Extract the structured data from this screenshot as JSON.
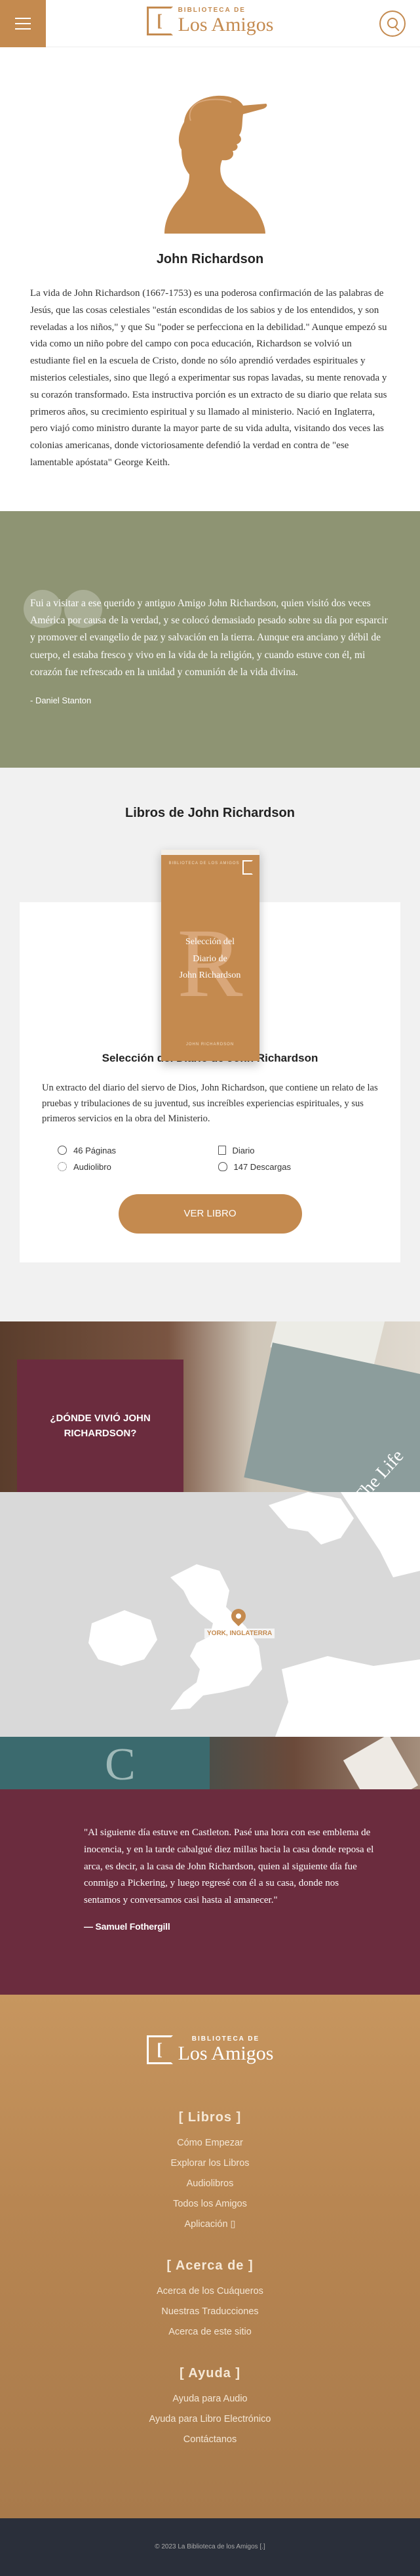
{
  "header": {
    "menu_icon": "hamburger-icon",
    "logo_small": "BIBLIOTECA DE",
    "logo_big": "Los Amigos",
    "logo_glyph": "[",
    "search_icon": "search-icon"
  },
  "bio": {
    "name": "John Richardson",
    "text": "La vida de John Richardson (1667-1753) es una poderosa confirmación de las palabras de Jesús, que las cosas celestiales \"están escondidas de los sabios y de los entendidos, y son reveladas a los niños,\" y que Su \"poder se perfecciona en la debilidad.\" Aunque empezó su vida como un niño pobre del campo con poca educación, Richardson se volvió un estudiante fiel en la escuela de Cristo, donde no sólo aprendió verdades espirituales y misterios celestiales, sino que llegó a experimentar sus ropas lavadas, su mente renovada y su corazón transformado. Esta instructiva porción es un extracto de su diario que relata sus primeros años, su crecimiento espiritual y su llamado al ministerio. Nació en Inglaterra, pero viajó como ministro durante la mayor parte de su vida adulta, visitando dos veces las colonias americanas, donde victoriosamente defendió la verdad en contra de \"ese lamentable apóstata\" George Keith."
  },
  "quote1": {
    "text": "Fui a visitar a ese querido y antiguo Amigo John Richardson, quien visitó dos veces América por causa de la verdad, y se colocó demasiado pesado sobre su día por esparcir y promover el evangelio de paz y salvación en la tierra. Aunque era anciano y débil de cuerpo, el estaba fresco y vivo en la vida de la religión, y cuando estuve con él, mi corazón fue refrescado en la unidad y comunión de la vida divina.",
    "author": "- Daniel Stanton"
  },
  "books": {
    "heading": "Libros de John Richardson",
    "cover": {
      "series": "BIBLIOTECA DE LOS AMIGOS",
      "letter": "R",
      "title_lines": [
        "Selección del",
        "Diario de",
        "John Richardson"
      ],
      "author": "JOHN RICHARDSON"
    },
    "title": "Selección del Diario de John Richardson",
    "description": "Un extracto del diario del siervo de Dios, John Richardson, que contiene un relato de las pruebas y tribulaciones de su juventud, sus increíbles experiencias espirituales, y sus primeros servicios en la obra del Ministerio.",
    "meta": {
      "pages": "46 Páginas",
      "type": "Diario",
      "audio": "Audiolibro",
      "downloads": "147 Descargas"
    },
    "button": "VER LIBRO"
  },
  "where": {
    "heading": "¿DÓNDE VIVIÓ JOHN RICHARDSON?",
    "book_letter": "The Life"
  },
  "map": {
    "location_label": "YORK, INGLATERRA"
  },
  "quote2": {
    "text": "\"Al siguiente día estuve en Castleton. Pasé una hora con ese emblema de inocencia, y en la tarde cabalgué diez millas hacia la casa donde reposa el arca, es decir, a la casa de John Richardson, quien al siguiente día fue conmigo a Pickering, y luego regresé con él a su casa, donde nos sentamos y conversamos casi hasta al amanecer.\"",
    "author": "— Samuel Fothergill"
  },
  "footer": {
    "logo_small": "BIBLIOTECA DE",
    "logo_big": "Los Amigos",
    "sections": [
      {
        "heading": "[ Libros ]",
        "links": [
          "Cómo Empezar",
          "Explorar los Libros",
          "Audiolibros",
          "Todos los Amigos",
          "Aplicación ▯"
        ]
      },
      {
        "heading": "[ Acerca de ]",
        "links": [
          "Acerca de los Cuáqueros",
          "Nuestras Traducciones",
          "Acerca de este sitio"
        ]
      },
      {
        "heading": "[ Ayuda ]",
        "links": [
          "Ayuda para Audio",
          "Ayuda para Libro Electrónico",
          "Contáctanos"
        ]
      }
    ]
  },
  "copyright": "© 2023 La Biblioteca de los Amigos [.]",
  "colors": {
    "accent": "#c48a4f",
    "green": "#8e9473",
    "maroon": "#6b2c3e",
    "dark": "#2a2f3a"
  }
}
